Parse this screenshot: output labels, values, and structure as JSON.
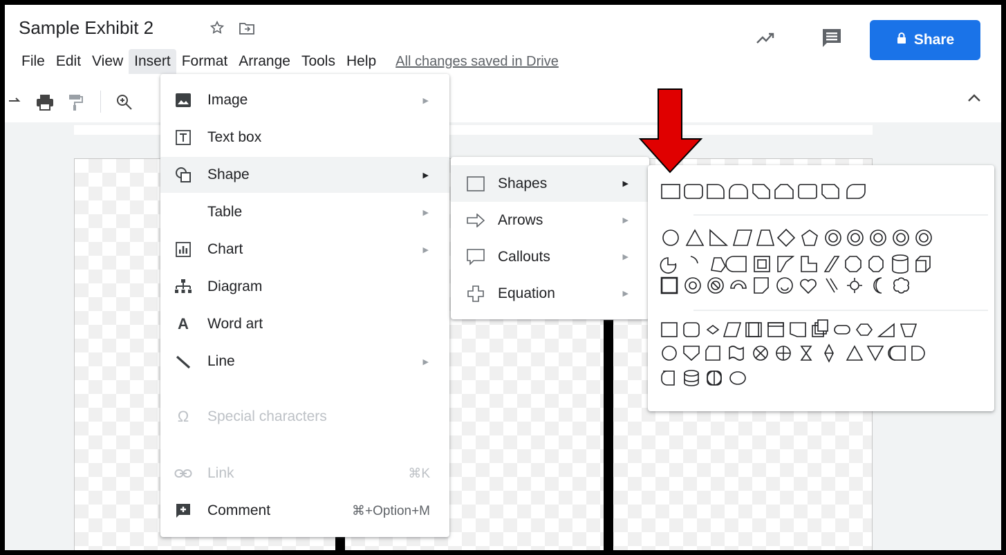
{
  "document": {
    "title": "Sample Exhibit 2"
  },
  "menubar": {
    "items": [
      "File",
      "Edit",
      "View",
      "Insert",
      "Format",
      "Arrange",
      "Tools",
      "Help"
    ],
    "saved_status": "All changes saved in Drive"
  },
  "header": {
    "share_label": "Share"
  },
  "insert_menu": {
    "image": "Image",
    "text_box": "Text box",
    "shape": "Shape",
    "table": "Table",
    "chart": "Chart",
    "diagram": "Diagram",
    "word_art": "Word art",
    "line": "Line",
    "special_characters": "Special characters",
    "link": "Link",
    "link_shortcut": "⌘K",
    "comment": "Comment",
    "comment_shortcut": "⌘+Option+M"
  },
  "shape_submenu": {
    "shapes": "Shapes",
    "arrows": "Arrows",
    "callouts": "Callouts",
    "equation": "Equation"
  },
  "colors": {
    "accent": "#1a73e8",
    "highlight_arrow": "#e00000"
  }
}
